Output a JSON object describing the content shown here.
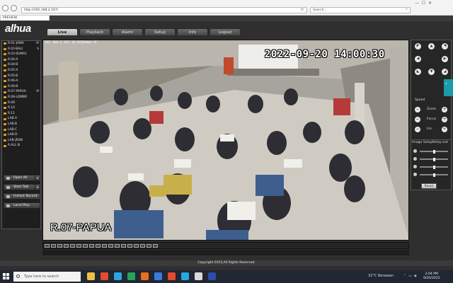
{
  "browser": {
    "url": "http://192.168.2.167/",
    "search_placeholder": "Search...",
    "tab_label": "PREVIEW"
  },
  "app": {
    "logo": "alhua",
    "tabs": [
      "Live",
      "Playback",
      "Alarm",
      "Setup",
      "Info",
      "Logout"
    ],
    "active_tab": "Live"
  },
  "channels": [
    {
      "label": "R.01-JAWA",
      "flag": "M"
    },
    {
      "label": "R.02-BALI",
      "flag": "S"
    },
    {
      "label": "R.03-SUMA1",
      "flag": ""
    },
    {
      "label": "R.04-A",
      "flag": ""
    },
    {
      "label": "R.04-B",
      "flag": ""
    },
    {
      "label": "R.05-A",
      "flag": ""
    },
    {
      "label": "R.05-B",
      "flag": ""
    },
    {
      "label": "R.06-A",
      "flag": ""
    },
    {
      "label": "R.06-B",
      "flag": ""
    },
    {
      "label": "R.07-PAPUA",
      "flag": "M"
    },
    {
      "label": "R.08-LOMBO",
      "flag": ""
    },
    {
      "label": "R.09",
      "flag": ""
    },
    {
      "label": "R.10",
      "flag": ""
    },
    {
      "label": "R.11",
      "flag": ""
    },
    {
      "label": "LAB-A",
      "flag": ""
    },
    {
      "label": "LAB-B",
      "flag": ""
    },
    {
      "label": "LAB-C",
      "flag": ""
    },
    {
      "label": "LAB-D",
      "flag": ""
    },
    {
      "label": "LAB-JRSN",
      "flag": ""
    },
    {
      "label": "A.ALL.N",
      "flag": ""
    }
  ],
  "side_buttons": {
    "open_all": "Open All",
    "start_talk": "Start Talk",
    "instant_record": "Instant Record",
    "local_play": "Local Play"
  },
  "video": {
    "stream_info": "192.168.2.167_10_9236kbps_M",
    "osd_time": "2022-09-20 14:00:30",
    "osd_channel": "R.07-PAPUA"
  },
  "ptz": {
    "speed_label": "Speed",
    "zoom_label": "Zoom",
    "focus_label": "Focus",
    "iris_label": "Iris"
  },
  "image_setup": {
    "title": "Image Setup",
    "relay_title": "Relay-out",
    "reset_label": "Reset",
    "sliders": [
      {
        "icon": "brightness-icon",
        "level": 0.5
      },
      {
        "icon": "contrast-icon",
        "level": 0.5
      },
      {
        "icon": "saturation-icon",
        "level": 0.5
      },
      {
        "icon": "hue-icon",
        "level": 0.5
      }
    ]
  },
  "footer": {
    "copyright": "Copyright 2015,All Rights Reserved."
  },
  "taskbar": {
    "search_placeholder": "Type here to search",
    "weather": "32°C Berawan",
    "time": "2:04 PM",
    "date": "9/20/2022",
    "app_colors": [
      "#f0c040",
      "#e34b2b",
      "#2aa6e0",
      "#27a35a",
      "#ea6f1a",
      "#3a7ad9",
      "#e34b2b",
      "#2aa6e0",
      "#d9d9d9",
      "#2b4fa8"
    ]
  }
}
